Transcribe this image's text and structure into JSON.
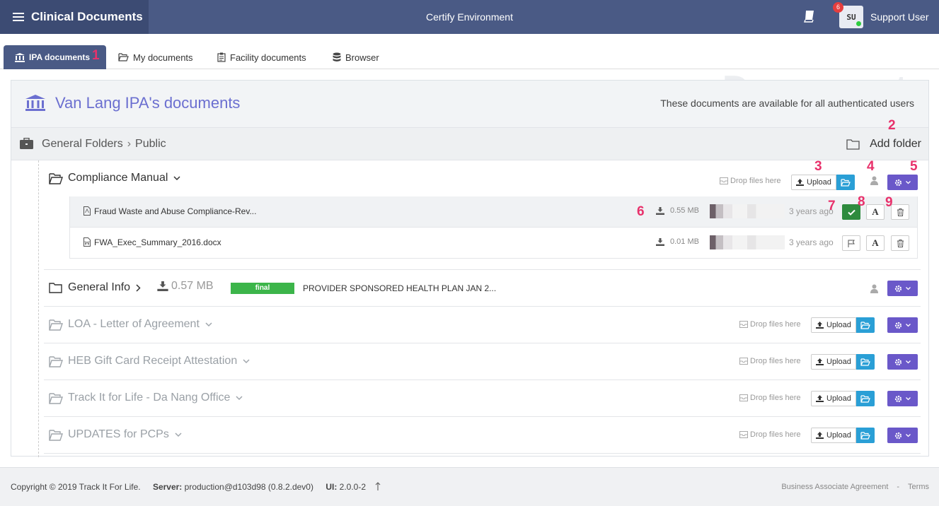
{
  "app": {
    "title": "Clinical Documents",
    "environment": "Certify Environment",
    "notifications": "6",
    "avatar_initials": "SU",
    "username": "Support User"
  },
  "tabs": [
    {
      "label": "IPA documents",
      "active": true
    },
    {
      "label": "My documents"
    },
    {
      "label": "Facility documents"
    },
    {
      "label": "Browser"
    }
  ],
  "background_title": "Documents",
  "callouts": [
    "1",
    "2",
    "3",
    "4",
    "5",
    "6",
    "7",
    "8",
    "9"
  ],
  "panel": {
    "title": "Van Lang IPA's documents",
    "note": "These documents are available for all authenticated users"
  },
  "breadcrumb": {
    "root": "General Folders",
    "sep": "›",
    "current": "Public"
  },
  "add_folder_label": "Add folder",
  "common": {
    "drop_label": "Drop files here",
    "upload_label": "Upload"
  },
  "folders": [
    {
      "name": "Compliance Manual",
      "files": [
        {
          "name": "Fraud Waste and Abuse Compliance-Rev...",
          "size": "0.55 MB",
          "time": "3 years ago"
        },
        {
          "name": "FWA_Exec_Summary_2016.docx",
          "size": "0.01 MB",
          "time": "3 years ago"
        }
      ]
    },
    {
      "name": "General Info",
      "size": "0.57 MB",
      "status": "final",
      "description": "PROVIDER SPONSORED HEALTH PLAN JAN 2..."
    },
    {
      "name": "LOA - Letter of Agreement"
    },
    {
      "name": "HEB Gift Card Receipt Attestation"
    },
    {
      "name": "Track It for Life - Da Nang Office"
    },
    {
      "name": "UPDATES for PCPs"
    }
  ],
  "footer": {
    "copyright": "Copyright © 2019 Track It For Life.",
    "server_label": "Server:",
    "server_value": "production@d103d98 (0.8.2.dev0)",
    "ui_label": "UI:",
    "ui_value": "2.0.0-2",
    "link_baa": "Business Associate Agreement",
    "link_sep": "-",
    "link_terms": "Terms"
  },
  "colors": {
    "topbar": "#4a5a85",
    "brand": "#3c4b73",
    "accent_purple": "#6a58c9",
    "accent_blue": "#2a9fd6",
    "success": "#3cb54a",
    "callout": "#e8316b"
  }
}
